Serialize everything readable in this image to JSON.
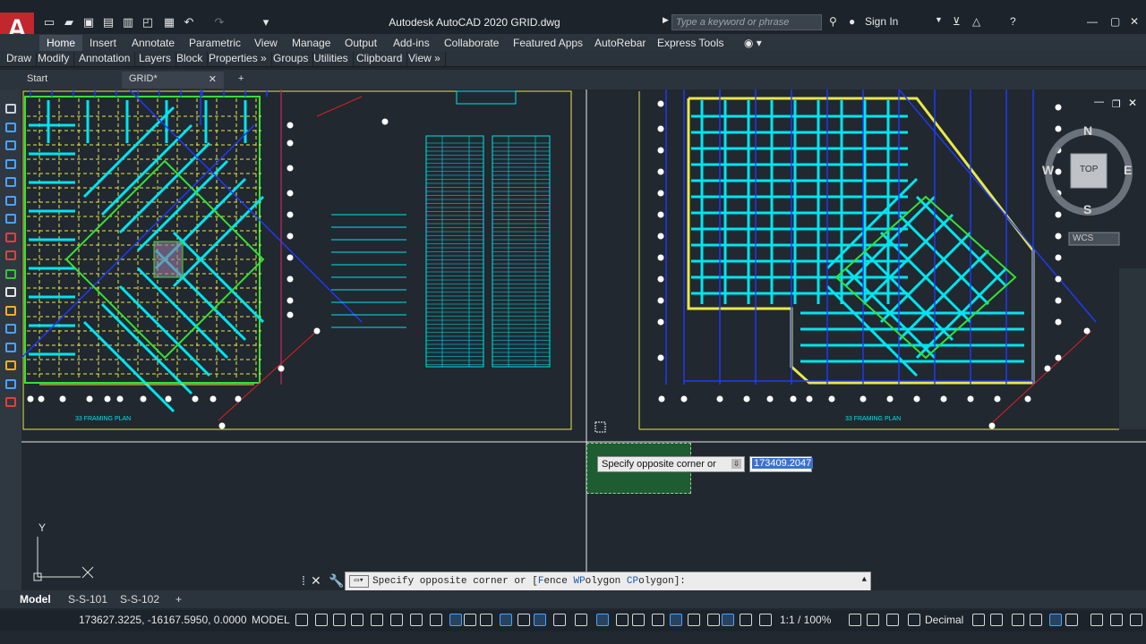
{
  "app": {
    "logo_letter": "A",
    "title": "Autodesk AutoCAD 2020   GRID.dwg",
    "search_placeholder": "Type a keyword or phrase",
    "sign_in": "Sign In"
  },
  "ribbon_tabs": [
    "Home",
    "Insert",
    "Annotate",
    "Parametric",
    "View",
    "Manage",
    "Output",
    "Add-ins",
    "Collaborate",
    "Featured Apps",
    "AutoRebar",
    "Express Tools"
  ],
  "ribbon_active": "Home",
  "panels": [
    "Draw",
    "Modify",
    "Annotation",
    "Layers",
    "Block",
    "Properties »",
    "Groups",
    "Utilities",
    "Clipboard",
    "View »"
  ],
  "file_tabs": {
    "start": "Start",
    "active": "GRID*"
  },
  "viewcube": {
    "n": "N",
    "s": "S",
    "e": "E",
    "w": "W",
    "face": "TOP",
    "wcs": "WCS"
  },
  "ucs": {
    "y": "Y",
    "x": "X"
  },
  "prompt": {
    "tooltip": "Specify opposite corner or",
    "value": "173409.2047"
  },
  "command": {
    "text_prefix": "Specify opposite corner or [",
    "opt1_hot": "F",
    "opt1": "ence",
    "opt2_hot": "WP",
    "opt2": "olygon",
    "opt3_hot": "CP",
    "opt3": "olygon",
    "text_suffix": "]:"
  },
  "layout_tabs": [
    "Model",
    "S-S-101",
    "S-S-102"
  ],
  "status": {
    "coords": "173627.3225, -16167.5950, 0.0000",
    "space": "MODEL",
    "scale": "1:1 / 100%",
    "units": "Decimal"
  },
  "colors": {
    "cyan": "#00e5ee",
    "yellow": "#e8e84a",
    "green": "#36e036",
    "blue": "#1f3bff",
    "red": "#e02020"
  }
}
